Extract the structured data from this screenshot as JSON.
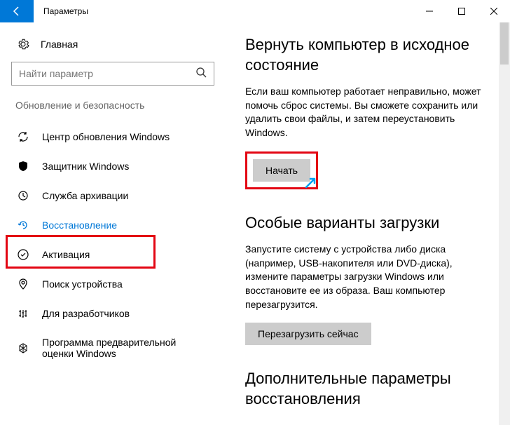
{
  "window": {
    "title": "Параметры"
  },
  "sidebar": {
    "home": "Главная",
    "search_placeholder": "Найти параметр",
    "section": "Обновление и безопасность",
    "items": [
      {
        "label": "Центр обновления Windows"
      },
      {
        "label": "Защитник Windows"
      },
      {
        "label": "Служба архивации"
      },
      {
        "label": "Восстановление"
      },
      {
        "label": "Активация"
      },
      {
        "label": "Поиск устройства"
      },
      {
        "label": "Для разработчиков"
      },
      {
        "label": "Программа предварительной оценки Windows"
      }
    ]
  },
  "main": {
    "reset": {
      "title": "Вернуть компьютер в исходное состояние",
      "text": "Если ваш компьютер работает неправильно, может помочь сброс системы. Вы сможете сохранить или удалить свои файлы, и затем переустановить Windows.",
      "button": "Начать"
    },
    "advanced": {
      "title": "Особые варианты загрузки",
      "text": "Запустите систему с устройства либо диска (например, USB-накопителя или DVD-диска), измените параметры загрузки Windows или восстановите ее из образа. Ваш компьютер перезагрузится.",
      "button": "Перезагрузить сейчас"
    },
    "more": {
      "title": "Дополнительные параметры восстановления"
    }
  }
}
